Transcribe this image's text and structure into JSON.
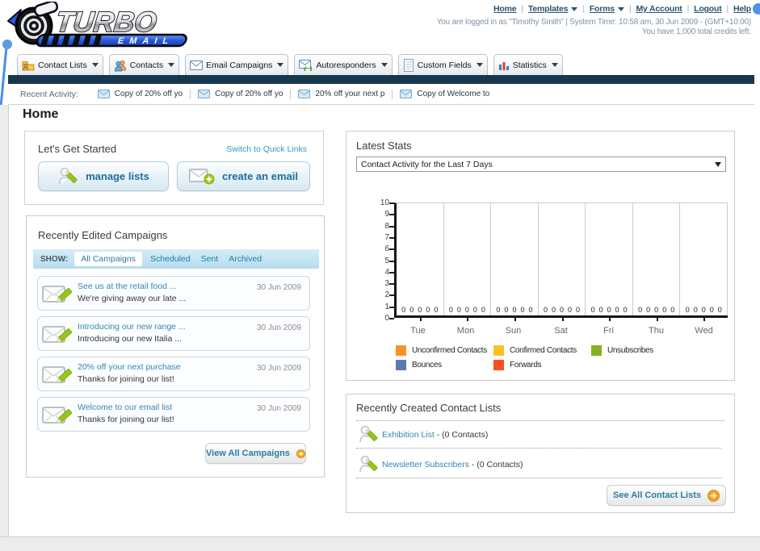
{
  "header": {
    "links": [
      "Home",
      "Templates",
      "Forms",
      "My Account",
      "Logout",
      "Help"
    ],
    "login_line": "You are logged in as \"Timothy Smith\" | System Time: 10:58 am, 30 Jun 2009 - (GMT+10:00)",
    "credits_line": "You have 1,000 total credits left.",
    "brand_top": "TURBO",
    "brand_bottom": "EMAIL"
  },
  "nav": {
    "tabs": [
      {
        "label": "Contact Lists"
      },
      {
        "label": "Contacts"
      },
      {
        "label": "Email Campaigns"
      },
      {
        "label": "Autoresponders"
      },
      {
        "label": "Custom Fields"
      },
      {
        "label": "Statistics"
      }
    ]
  },
  "activity": {
    "label": "Recent Activity:",
    "items": [
      "Copy of 20% off yo",
      "Copy of 20% off yo",
      "20% off your next p",
      "Copy of Welcome to"
    ]
  },
  "page": {
    "title": "Home"
  },
  "get_started": {
    "title": "Let's Get Started",
    "switch_link": "Switch to Quick Links",
    "manage_lists_label": "manage lists",
    "create_email_label": "create an email"
  },
  "campaigns": {
    "title": "Recently Edited Campaigns",
    "show_label": "SHOW:",
    "filters": [
      "All Campaigns",
      "Scheduled",
      "Sent",
      "Archived"
    ],
    "active_filter": "All Campaigns",
    "rows": [
      {
        "title": "See us at the retail food ...",
        "subtitle": "We're giving away our late ...",
        "date": "30 Jun 2009"
      },
      {
        "title": "Introducing our new range ...",
        "subtitle": "Introducing our new Italia ...",
        "date": "30 Jun 2009"
      },
      {
        "title": "20% off your next purchase",
        "subtitle": "Thanks for joining our list!",
        "date": "30 Jun 2009"
      },
      {
        "title": "Welcome to our email list",
        "subtitle": "Thanks for joining our list!",
        "date": "30 Jun 2009"
      }
    ],
    "view_all_label": "View All Campaigns"
  },
  "stats": {
    "title": "Latest Stats",
    "dropdown_value": "Contact Activity for the Last 7 Days",
    "chart_data": {
      "type": "bar",
      "categories": [
        "Tue",
        "Mon",
        "Sun",
        "Sat",
        "Fri",
        "Thu",
        "Wed"
      ],
      "series": [
        {
          "name": "Unconfirmed Contacts",
          "color": "#fa902a",
          "values": [
            0,
            0,
            0,
            0,
            0,
            0,
            0
          ]
        },
        {
          "name": "Confirmed Contacts",
          "color": "#fdc123",
          "values": [
            0,
            0,
            0,
            0,
            0,
            0,
            0
          ]
        },
        {
          "name": "Unsubscribes",
          "color": "#85b221",
          "values": [
            0,
            0,
            0,
            0,
            0,
            0,
            0
          ]
        },
        {
          "name": "Bounces",
          "color": "#5e77ad",
          "values": [
            0,
            0,
            0,
            0,
            0,
            0,
            0
          ]
        },
        {
          "name": "Forwards",
          "color": "#f94d25",
          "values": [
            0,
            0,
            0,
            0,
            0,
            0,
            0
          ]
        }
      ],
      "ylim": [
        0,
        10
      ],
      "yticks": [
        0,
        1,
        2,
        3,
        4,
        5,
        6,
        7,
        8,
        9,
        10
      ],
      "grid": "vertical",
      "legend_position": "bottom"
    }
  },
  "contact_lists": {
    "title": "Recently Created Contact Lists",
    "items": [
      {
        "name": "Exhibition List",
        "suffix": " - (0 Contacts)"
      },
      {
        "name": "Newsletter Subscribers",
        "suffix": " - (0 Contacts)"
      }
    ],
    "see_all_label": "See All Contact Lists"
  }
}
